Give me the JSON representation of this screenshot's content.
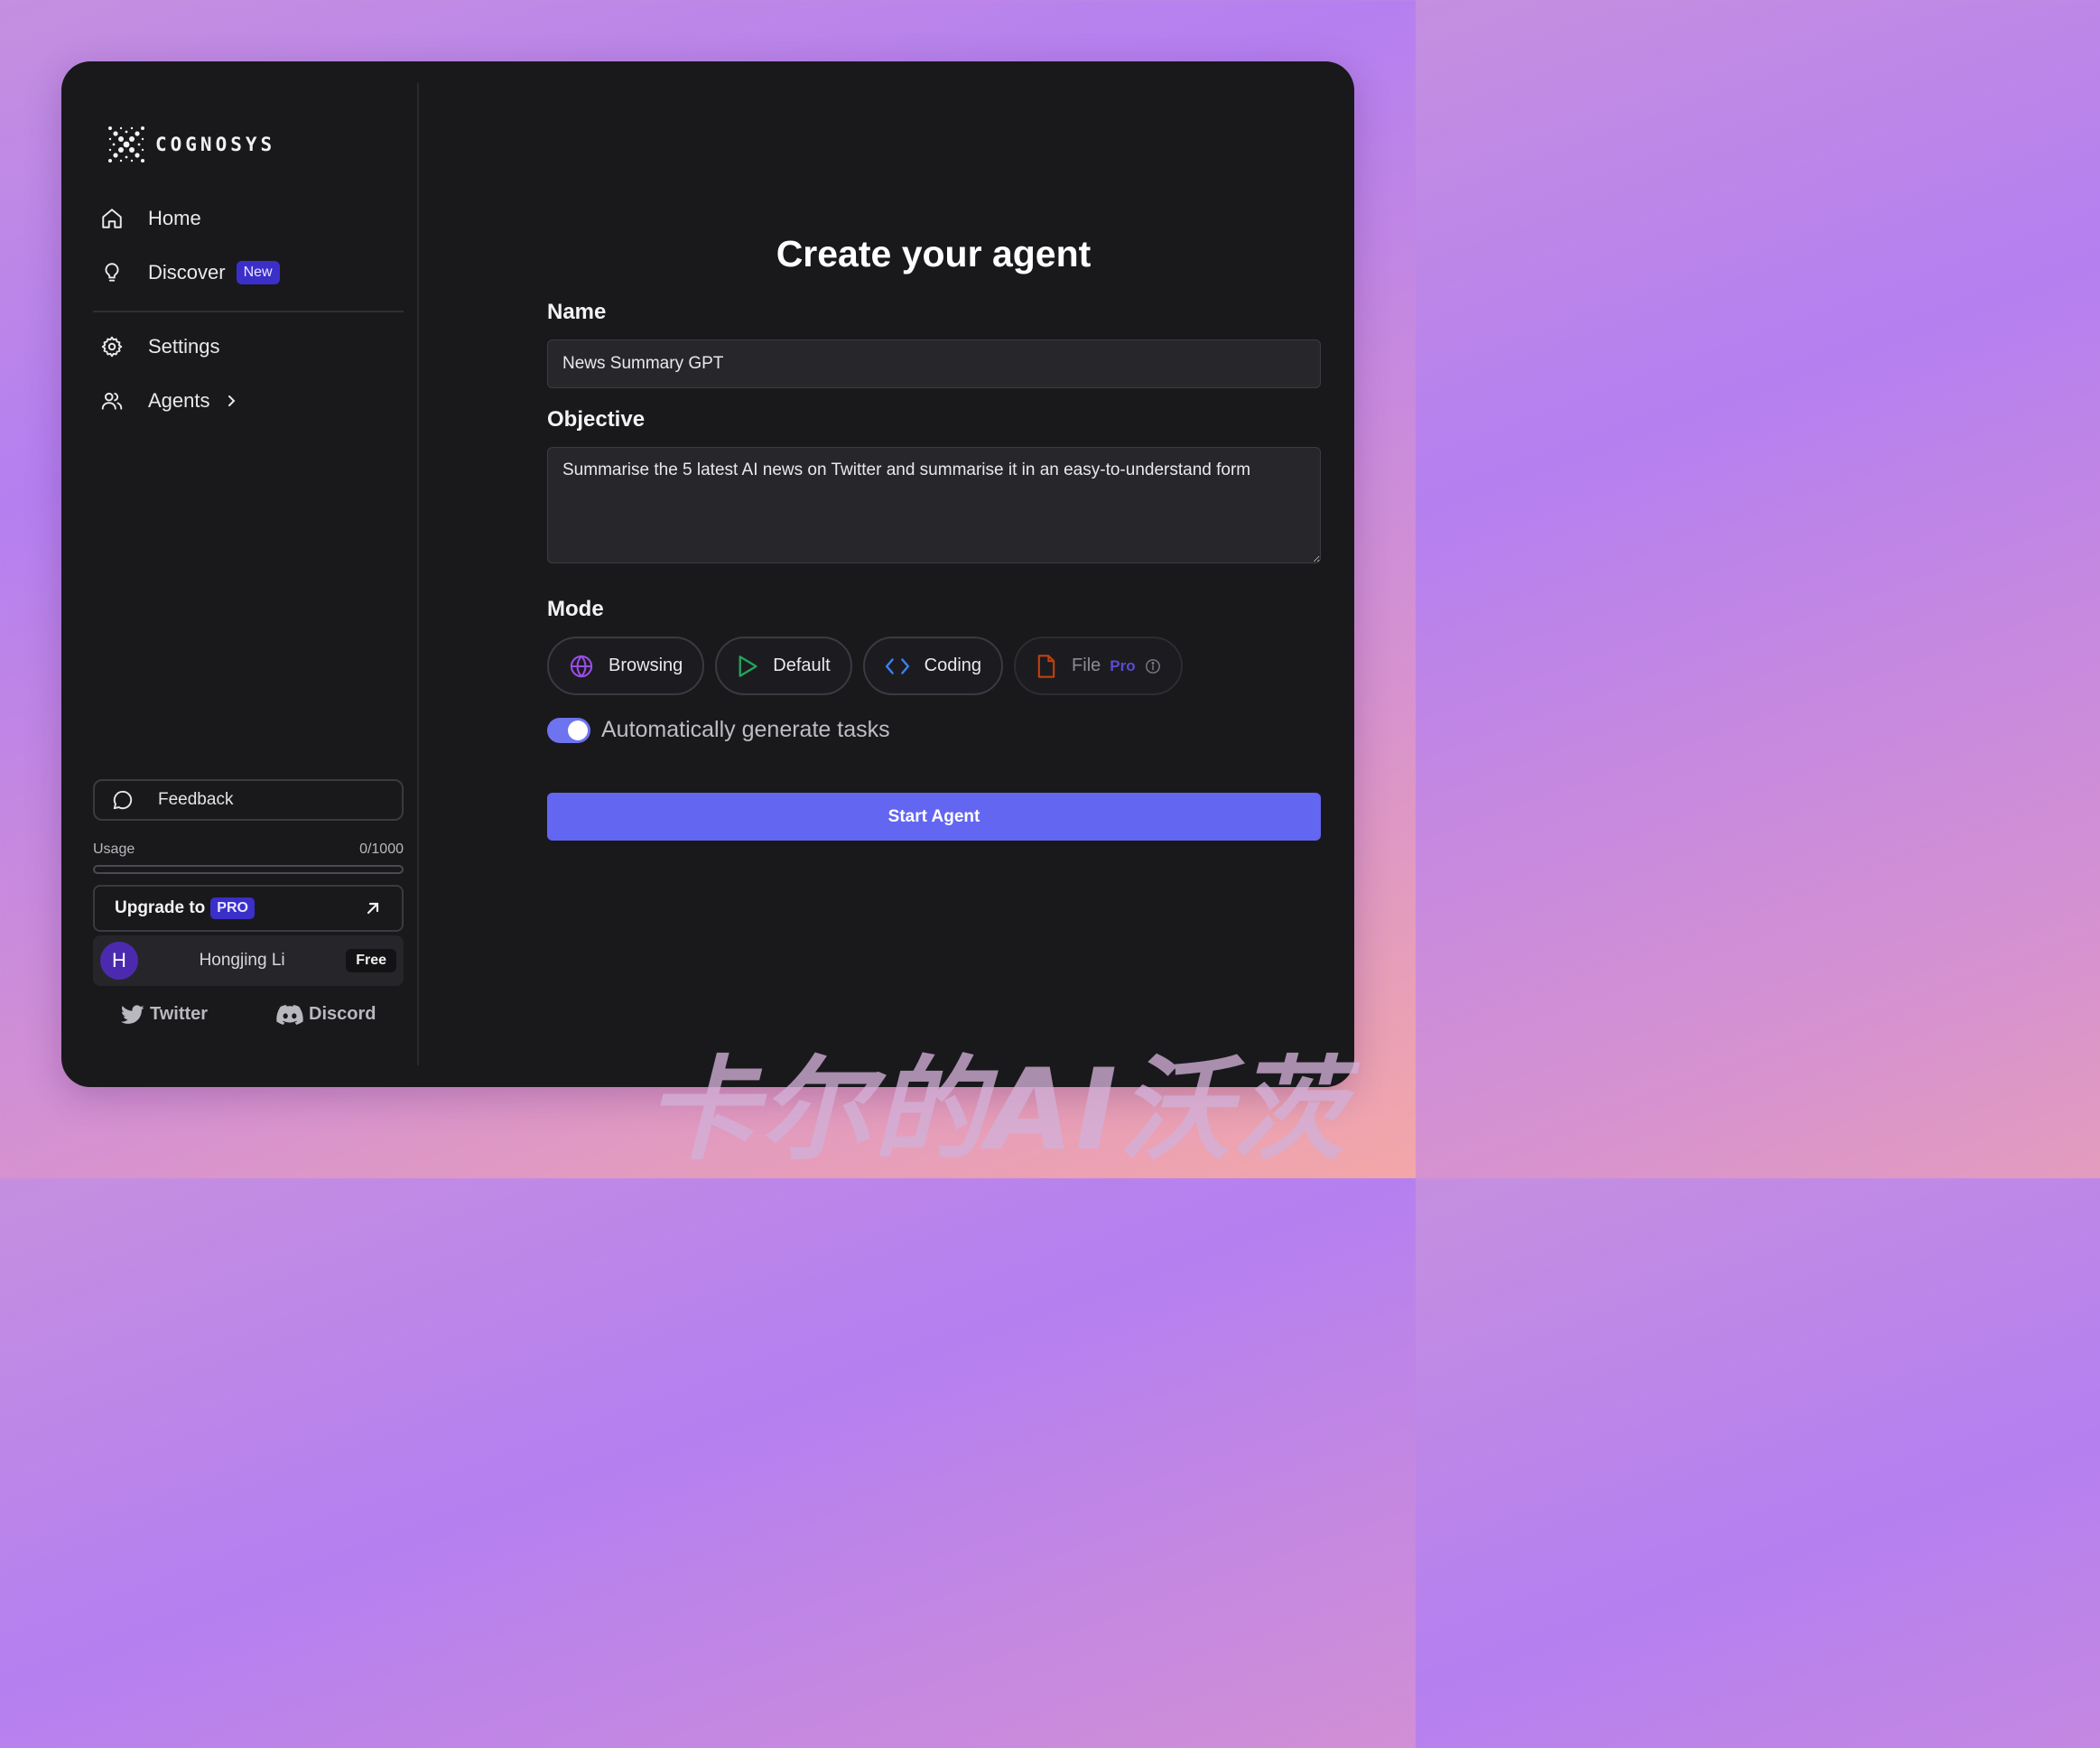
{
  "brand": {
    "name": "COGNOSYS"
  },
  "sidebar": {
    "items": [
      {
        "label": "Home",
        "icon": "home-icon"
      },
      {
        "label": "Discover",
        "icon": "lightbulb-icon",
        "badge": "New"
      },
      {
        "label": "Settings",
        "icon": "gear-icon"
      },
      {
        "label": "Agents",
        "icon": "users-icon"
      }
    ],
    "feedback_label": "Feedback",
    "usage": {
      "label": "Usage",
      "value": "0/1000",
      "fraction": 0
    },
    "upgrade": {
      "label": "Upgrade to",
      "badge": "PRO"
    },
    "user": {
      "initial": "H",
      "name": "Hongjing Li",
      "plan": "Free"
    },
    "social": {
      "twitter": "Twitter",
      "discord": "Discord"
    }
  },
  "main": {
    "title": "Create your agent",
    "name_label": "Name",
    "name_value": "News Summary GPT",
    "objective_label": "Objective",
    "objective_value": "Summarise the 5 latest AI news on Twitter and summarise it in an easy-to-understand form",
    "mode_label": "Mode",
    "modes": [
      {
        "label": "Browsing",
        "icon": "globe-icon",
        "color": "#9a4de6"
      },
      {
        "label": "Default",
        "icon": "play-icon",
        "color": "#22a45d"
      },
      {
        "label": "Coding",
        "icon": "code-icon",
        "color": "#3b82f6"
      },
      {
        "label": "File",
        "icon": "file-icon",
        "color": "#c2410c",
        "badge": "Pro"
      }
    ],
    "auto_tasks_label": "Automatically generate tasks",
    "auto_tasks_on": true,
    "start_label": "Start Agent"
  },
  "watermark": "卡尔的AI沃茨",
  "colors": {
    "accent": "#6366f1",
    "badge": "#3b2fc9",
    "panel": "#19191c"
  }
}
